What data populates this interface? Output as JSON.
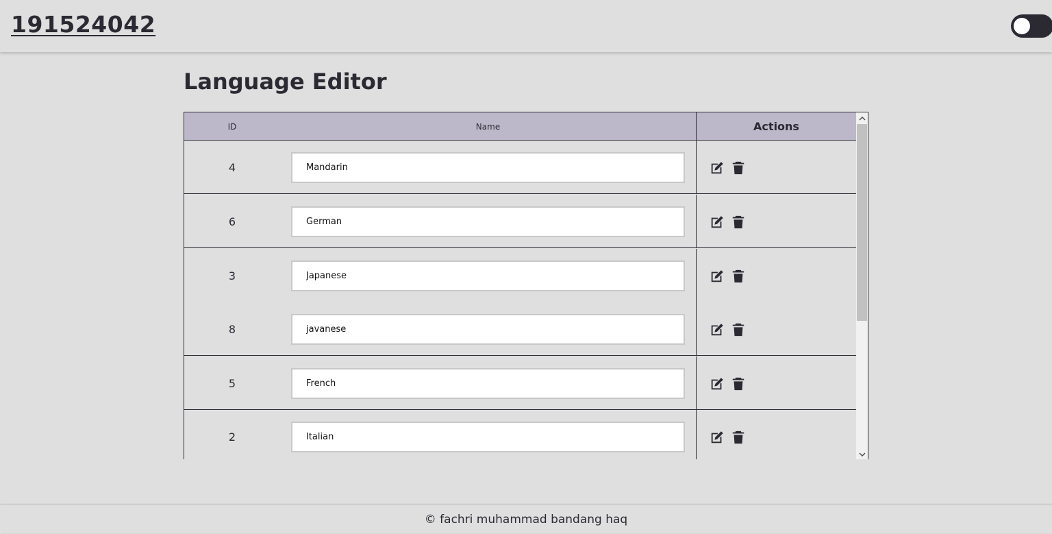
{
  "header": {
    "brand": "191524042",
    "theme_toggle_state": "dark-off"
  },
  "page": {
    "title": "Language Editor"
  },
  "table": {
    "headers": {
      "id": "ID",
      "name": "Name",
      "actions": "Actions"
    },
    "rows": [
      {
        "id": "4",
        "name": "Mandarin"
      },
      {
        "id": "6",
        "name": "German"
      },
      {
        "id": "3",
        "name": "Japanese"
      },
      {
        "id": "8",
        "name": "javanese"
      },
      {
        "id": "5",
        "name": "French"
      },
      {
        "id": "2",
        "name": "Italian"
      }
    ],
    "row_actions": [
      "edit-icon",
      "trash-icon"
    ]
  },
  "footer": {
    "copyright": "© fachri muhammad bandang haq"
  },
  "colors": {
    "background": "#dfdfdf",
    "header_row": "#bcb8c9",
    "text": "#2b2a33",
    "toggle": "#2b2a33"
  }
}
